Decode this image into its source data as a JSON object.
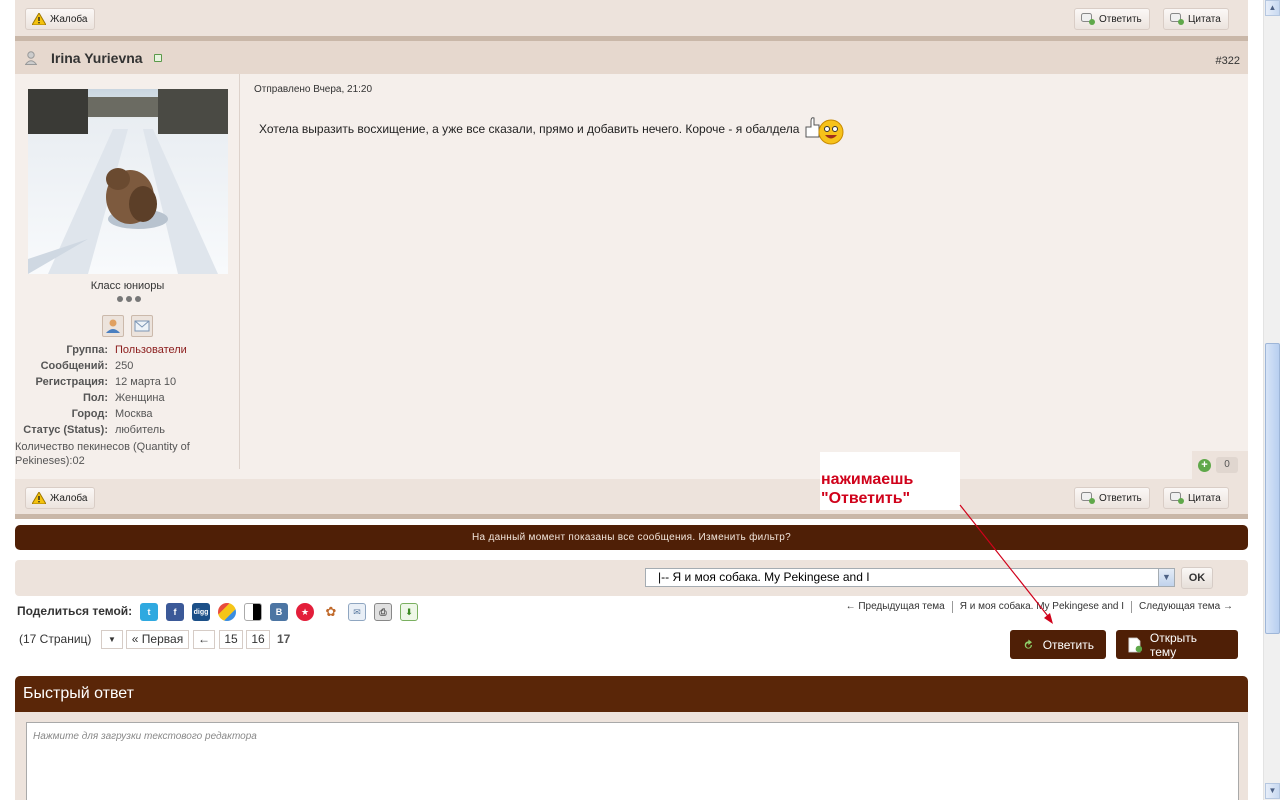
{
  "post_top_bar": {
    "report_label": "Жалоба",
    "reply_label": "Ответить",
    "quote_label": "Цитата"
  },
  "post": {
    "author": "Irina Yurievna",
    "number": "#322",
    "posted": "Отправлено Вчера, 21:20",
    "message": "Хотела выразить восхищение, а уже все сказали, прямо и добавить нечего. Короче - я обалдела",
    "rank": "Класс юниоры",
    "info": [
      {
        "key": "Группа:",
        "value": "Пользователи"
      },
      {
        "key": "Сообщений:",
        "value": "250"
      },
      {
        "key": "Регистрация:",
        "value": "12 марта 10"
      },
      {
        "key": "Пол:",
        "value": "Женщина"
      },
      {
        "key": "Город:",
        "value": "Москва"
      },
      {
        "key": "Статус (Status):",
        "value": "любитель"
      }
    ],
    "custom_field": "Количество пекинесов (Quantity of Pekineses):02",
    "reputation": "0"
  },
  "post_bottom_bar": {
    "report_label": "Жалоба",
    "reply_label": "Ответить",
    "quote_label": "Цитата"
  },
  "filter_notice": "На данный момент показаны все сообщения. Изменить фильтр?",
  "jump": {
    "selected": "|-- Я и моя собака. My Pekingese and I",
    "ok_label": "OK"
  },
  "share": {
    "label": "Поделиться темой:",
    "icons": [
      "twitter-icon",
      "facebook-icon",
      "digg-icon",
      "buzz-icon",
      "delicious-icon",
      "vkontakte-icon",
      "odnoklassniki-icon",
      "moimir-icon",
      "email-icon",
      "print-icon",
      "download-icon"
    ]
  },
  "topic_nav": {
    "prev": "← Предыдущая тема",
    "current": "Я и моя собака. My Pekingese and I",
    "next": "Следующая тема →"
  },
  "pagination": {
    "count": "(17 Страниц)",
    "first": "« Первая",
    "prev": "←",
    "pages": [
      "15",
      "16"
    ],
    "current": "17"
  },
  "actions": {
    "reply": "Ответить",
    "new_topic": "Открыть тему"
  },
  "quick_reply": {
    "title": "Быстрый ответ",
    "placeholder": "Нажмите для загрузки текстового редактора"
  },
  "annotation": {
    "line1": "нажимаешь",
    "line2": "\"Ответить\""
  },
  "colors": {
    "brand": "#4f1f06",
    "post_bg": "#f5efeb",
    "bar_bg": "#ede3dc",
    "link": "#8b1c1c",
    "annotation": "#d0021b"
  }
}
